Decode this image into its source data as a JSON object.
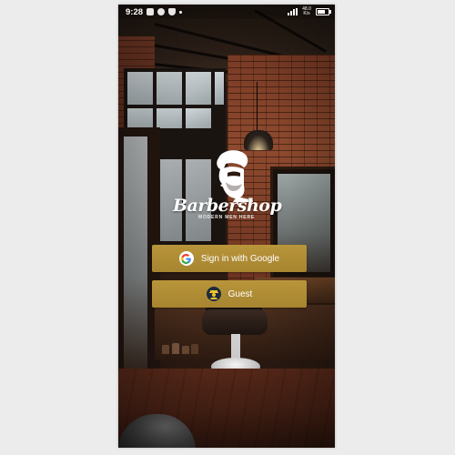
{
  "status_bar": {
    "time": "9:28",
    "network_speed": "48.0\nK/s",
    "icons": [
      "photo-icon",
      "soccer-icon",
      "shield-icon",
      "dot-icon"
    ],
    "right_icons": [
      "signal-icon",
      "battery-icon"
    ]
  },
  "logo": {
    "brand": "Barbershop",
    "tagline": "MODERN MEN HERE"
  },
  "buttons": {
    "google_label": "Sign in with Google",
    "guest_label": "Guest"
  },
  "colors": {
    "button_gold": "#b08c35",
    "button_text": "#ffffff"
  }
}
